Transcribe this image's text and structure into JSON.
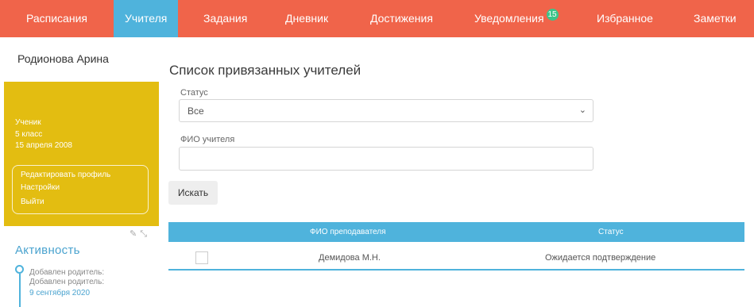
{
  "nav": {
    "items": [
      {
        "label": "Расписания"
      },
      {
        "label": "Учителя"
      },
      {
        "label": "Задания"
      },
      {
        "label": "Дневник"
      },
      {
        "label": "Достижения"
      },
      {
        "label": "Уведомления"
      },
      {
        "label": "Избранное"
      },
      {
        "label": "Заметки"
      }
    ],
    "active": "Учителя",
    "notifications_badge": "15"
  },
  "sidebar": {
    "student_name": "Родионова Арина",
    "profile": {
      "role": "Ученик",
      "grade": "5 класс",
      "birth_date": "15 апреля 2008",
      "links": [
        "Редактировать профиль",
        "Настройки",
        "Выйти"
      ]
    },
    "activity": {
      "title": "Активность",
      "items": [
        "Добавлен родитель:",
        "Добавлен родитель:"
      ],
      "date": "9 сентября 2020"
    }
  },
  "main": {
    "title": "Список привязанных учителей",
    "status_label": "Статус",
    "status_value": "Все",
    "teacher_label": "ФИО учителя",
    "teacher_value": "",
    "search_button": "Искать",
    "table": {
      "columns": [
        "ФИО преподавателя",
        "Статус"
      ],
      "rows": [
        {
          "name": "Демидова М.Н.",
          "status": "Ожидается подтверждение"
        }
      ]
    }
  },
  "colors": {
    "nav_bg": "#f0644a",
    "nav_active": "#4fb3dc",
    "profile_card": "#e3bd11",
    "table_header": "#4fb3dc",
    "badge": "#3cc48a"
  }
}
